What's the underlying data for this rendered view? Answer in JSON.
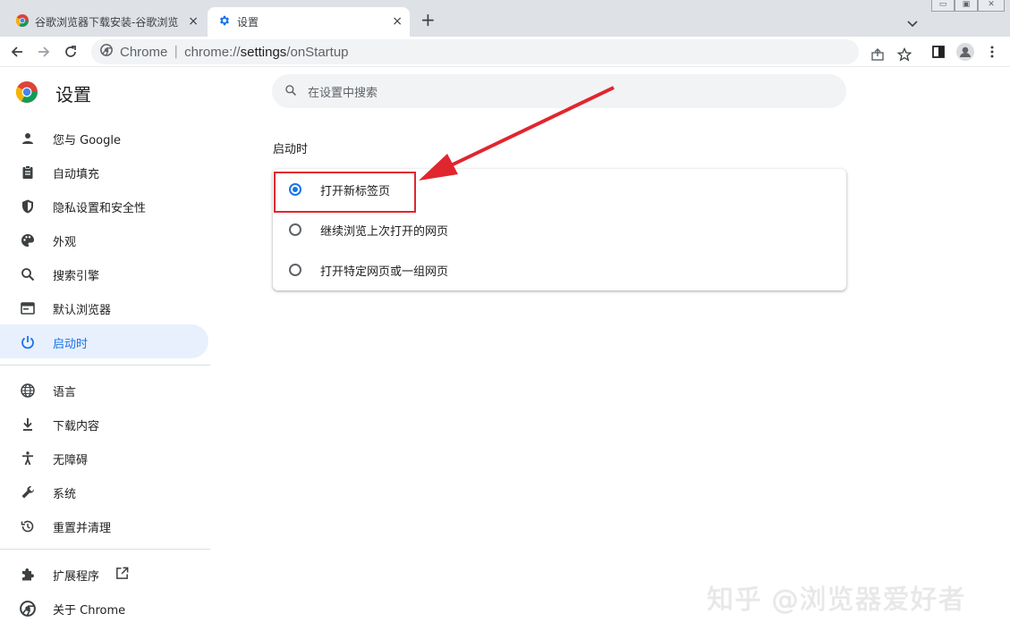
{
  "tabs": [
    {
      "title": "谷歌浏览器下载安装-谷歌浏览器",
      "close": "×"
    },
    {
      "title": "设置",
      "close": "×"
    }
  ],
  "new_tab": "+",
  "window_controls": {
    "minimize": "▭",
    "restore": "▣",
    "close": "✕"
  },
  "omnibox": {
    "site_name": "Chrome",
    "separator": "|",
    "url_prefix": "chrome://",
    "url_host": "settings",
    "url_path": "/onStartup"
  },
  "settings": {
    "title": "设置"
  },
  "sidebar": {
    "items": [
      {
        "label": "您与 Google",
        "icon": "person-icon"
      },
      {
        "label": "自动填充",
        "icon": "clipboard-icon"
      },
      {
        "label": "隐私设置和安全性",
        "icon": "shield-icon"
      },
      {
        "label": "外观",
        "icon": "palette-icon"
      },
      {
        "label": "搜索引擎",
        "icon": "search-icon"
      },
      {
        "label": "默认浏览器",
        "icon": "browser-icon"
      },
      {
        "label": "启动时",
        "icon": "power-icon"
      },
      {
        "label": "语言",
        "icon": "globe-icon"
      },
      {
        "label": "下载内容",
        "icon": "download-icon"
      },
      {
        "label": "无障碍",
        "icon": "accessibility-icon"
      },
      {
        "label": "系统",
        "icon": "wrench-icon"
      },
      {
        "label": "重置并清理",
        "icon": "history-icon"
      },
      {
        "label": "扩展程序",
        "icon": "puzzle-icon"
      },
      {
        "label": "关于 Chrome",
        "icon": "chrome-icon"
      }
    ],
    "selected_index": 6
  },
  "search": {
    "placeholder": "在设置中搜索"
  },
  "startup": {
    "section_title": "启动时",
    "options": [
      {
        "label": "打开新标签页",
        "checked": true
      },
      {
        "label": "继续浏览上次打开的网页",
        "checked": false
      },
      {
        "label": "打开特定网页或一组网页",
        "checked": false
      }
    ]
  },
  "watermark": "知乎 @浏览器爱好者",
  "colors": {
    "accent": "#1a73e8",
    "selected_bg": "#e8f0fe",
    "annotation_red": "#e0262f"
  }
}
